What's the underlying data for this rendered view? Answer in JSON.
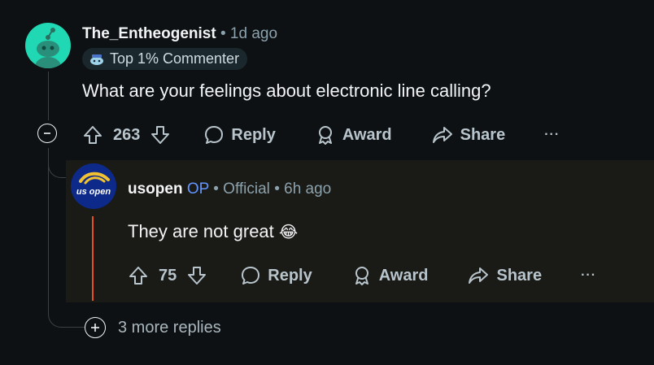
{
  "comment": {
    "username": "The_Entheogenist",
    "separator": "•",
    "time": "1d ago",
    "badge": "Top 1% Commenter",
    "text": "What are your feelings about electronic line calling?",
    "votes": "263",
    "reply_label": "Reply",
    "award_label": "Award",
    "share_label": "Share",
    "more_label": "···"
  },
  "reply": {
    "avatar_text": "us open",
    "username": "usopen",
    "op_label": "OP",
    "separator1": "•",
    "flair": "Official",
    "separator2": "•",
    "time": "6h ago",
    "text": "They are not great",
    "emoji": "😂",
    "votes": "75",
    "reply_label": "Reply",
    "award_label": "Award",
    "share_label": "Share",
    "more_label": "···"
  },
  "more_replies": {
    "label": "3 more replies"
  }
}
